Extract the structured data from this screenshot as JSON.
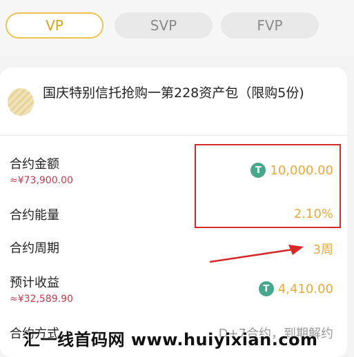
{
  "tabs": [
    {
      "label": "VP",
      "active": true
    },
    {
      "label": "SVP",
      "active": false
    },
    {
      "label": "FVP",
      "active": false
    }
  ],
  "product": {
    "title": "国庆特别信托抢购一第228资产包（限购5份)"
  },
  "rows": {
    "amount": {
      "label": "合约金额",
      "sub": "≈¥73,900.00",
      "value": "10,000.00",
      "coin": "T"
    },
    "energy": {
      "label": "合约能量",
      "value": "2.10%"
    },
    "period": {
      "label": "合约周期",
      "value": "3周"
    },
    "income": {
      "label": "预计收益",
      "sub": "≈¥32,589.90",
      "value": "4,410.00",
      "coin": "T"
    },
    "method": {
      "label": "合约方式",
      "value": "D+7合约，到期解约"
    }
  },
  "watermark": "汇一线首码网 www.huiyixian.com",
  "colors": {
    "accent": "#e8a93a",
    "sub": "#c03a4d",
    "coin": "#47a88e",
    "box": "#d62828"
  }
}
